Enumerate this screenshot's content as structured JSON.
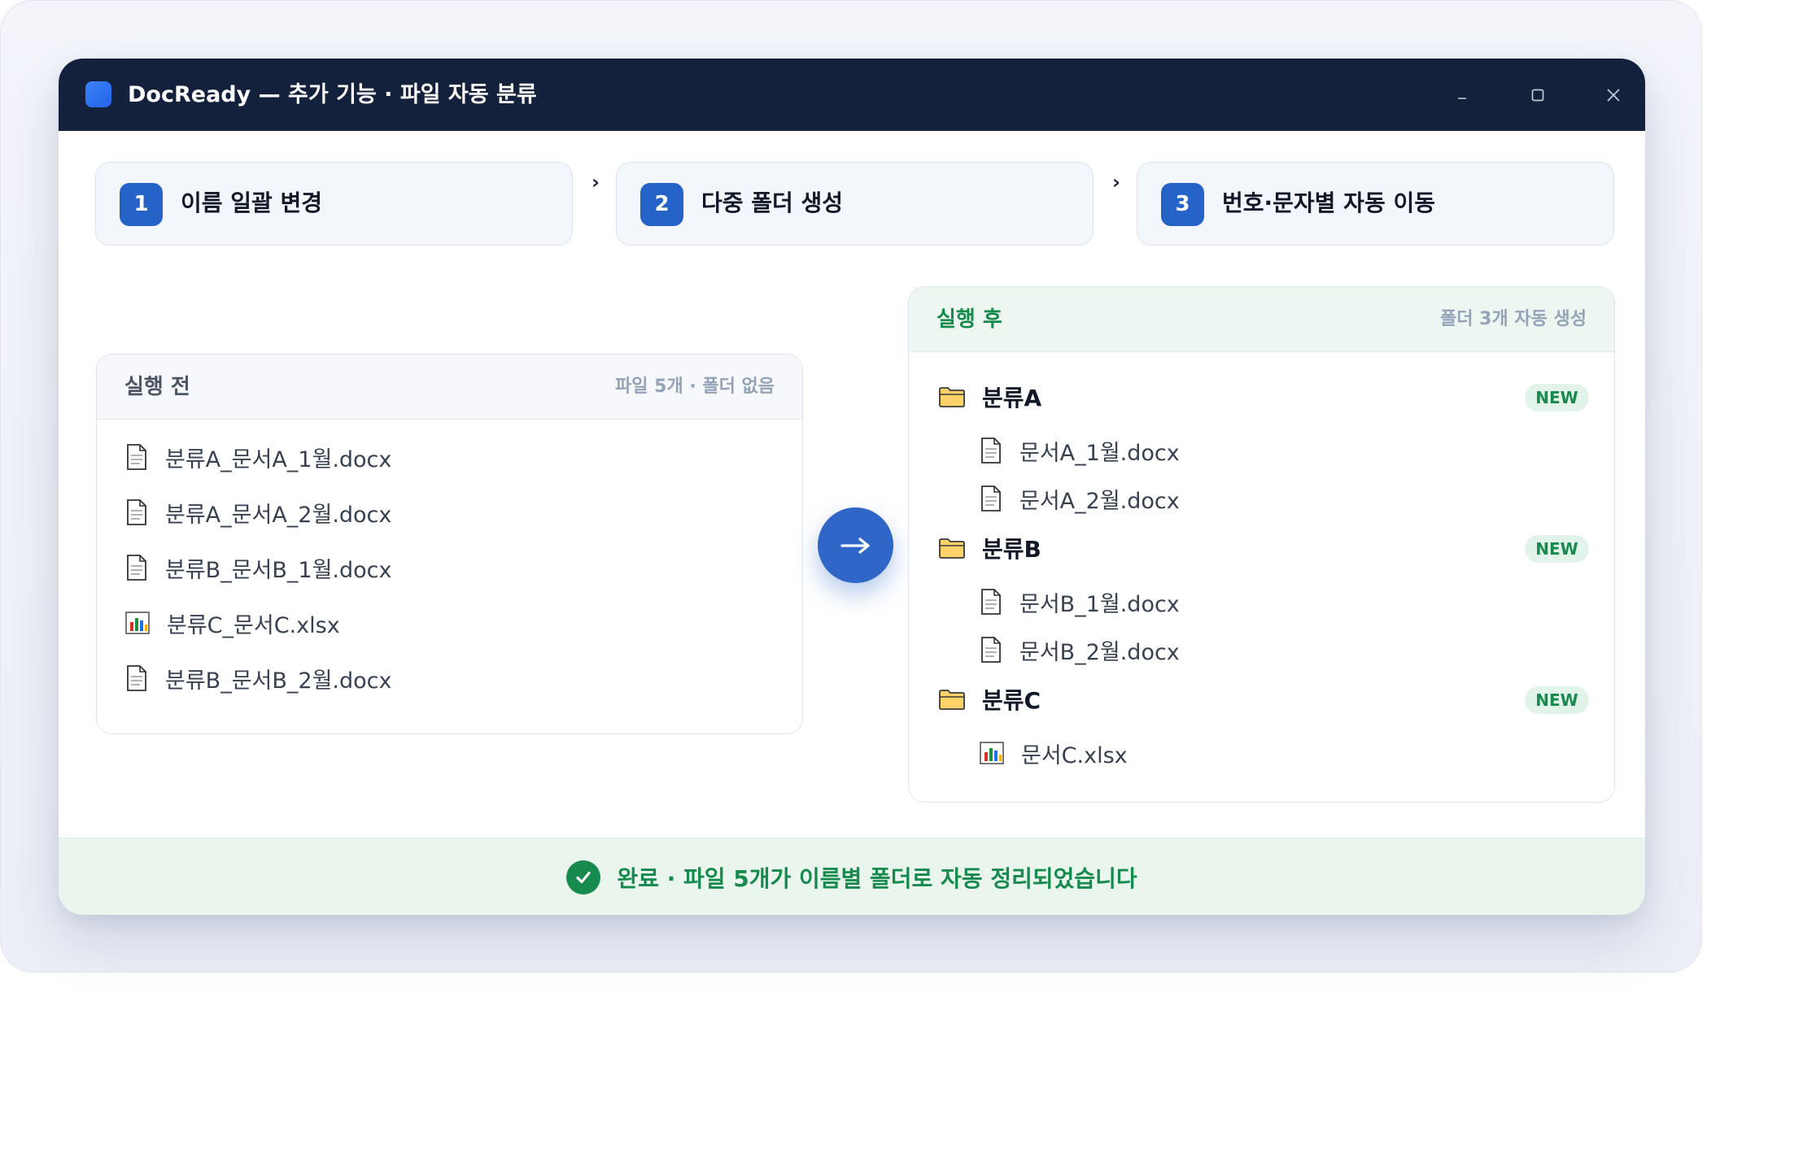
{
  "window": {
    "title": "DocReady — 추가 기능 · 파일 자동 분류"
  },
  "steps": [
    {
      "number": "1",
      "label": "이름 일괄 변경"
    },
    {
      "number": "2",
      "label": "다중 폴더 생성"
    },
    {
      "number": "3",
      "label": "번호·문자별 자동 이동"
    }
  ],
  "before": {
    "title": "실행 전",
    "meta": "파일 5개 · 폴더 없음",
    "files": [
      {
        "name": "분류A_문서A_1월.docx",
        "icon": "document-icon"
      },
      {
        "name": "분류A_문서A_2월.docx",
        "icon": "document-icon"
      },
      {
        "name": "분류B_문서B_1월.docx",
        "icon": "document-icon"
      },
      {
        "name": "분류C_문서C.xlsx",
        "icon": "spreadsheet-icon"
      },
      {
        "name": "분류B_문서B_2월.docx",
        "icon": "document-icon"
      }
    ]
  },
  "after": {
    "title": "실행 후",
    "meta": "폴더 3개 자동 생성",
    "folders": [
      {
        "name": "분류A",
        "badge": "NEW",
        "files": [
          {
            "name": "문서A_1월.docx",
            "icon": "document-icon"
          },
          {
            "name": "문서A_2월.docx",
            "icon": "document-icon"
          }
        ]
      },
      {
        "name": "분류B",
        "badge": "NEW",
        "files": [
          {
            "name": "문서B_1월.docx",
            "icon": "document-icon"
          },
          {
            "name": "문서B_2월.docx",
            "icon": "document-icon"
          }
        ]
      },
      {
        "name": "분류C",
        "badge": "NEW",
        "files": [
          {
            "name": "문서C.xlsx",
            "icon": "spreadsheet-icon"
          }
        ]
      }
    ]
  },
  "status": {
    "text": "완료 · 파일 5개가 이름별 폴더로 자동 정리되었습니다"
  },
  "colors": {
    "titlebar": "#14213d",
    "accent": "#2563c9",
    "success": "#178a4d"
  }
}
